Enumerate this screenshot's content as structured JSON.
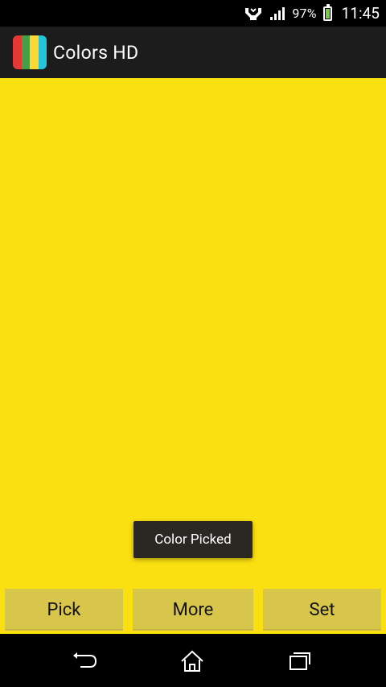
{
  "status_bar": {
    "battery_percent": "97%",
    "time": "11:45",
    "battery_level": 0.97,
    "icons": [
      "network-icon",
      "signal-icon",
      "battery-icon"
    ]
  },
  "action_bar": {
    "app_title": "Colors HD",
    "logo_colors": [
      "#e53935",
      "#43a047",
      "#fdd835",
      "#26c6da"
    ]
  },
  "content": {
    "background_color": "#fae010",
    "toast_text": "Color Picked"
  },
  "buttons": {
    "pick": "Pick",
    "more": "More",
    "set": "Set"
  },
  "nav_bar": {
    "icons": [
      "back-icon",
      "home-icon",
      "recent-apps-icon"
    ]
  }
}
